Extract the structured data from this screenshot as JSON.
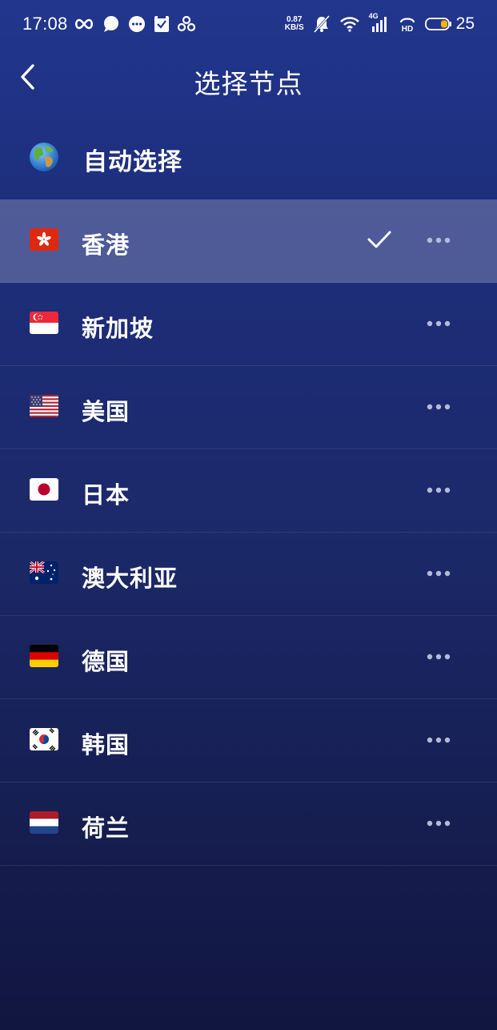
{
  "status_bar": {
    "time": "17:08",
    "net_speed_value": "0.87",
    "net_speed_unit": "KB/S",
    "network_type": "4G",
    "battery_level": "25",
    "icons": [
      "infinity-icon",
      "chat-bubble-icon",
      "message-icon",
      "clipboard-icon",
      "link-icon",
      "mute-icon",
      "wifi-icon",
      "signal-icon",
      "hd-icon",
      "battery-icon"
    ]
  },
  "header": {
    "back_icon": "chevron-left-icon",
    "title": "选择节点"
  },
  "auto_select": {
    "icon": "globe-icon",
    "label": "自动选择"
  },
  "servers": [
    {
      "name": "香港",
      "flag": "hong-kong-flag-icon",
      "selected": true
    },
    {
      "name": "新加坡",
      "flag": "singapore-flag-icon",
      "selected": false
    },
    {
      "name": "美国",
      "flag": "us-flag-icon",
      "selected": false
    },
    {
      "name": "日本",
      "flag": "japan-flag-icon",
      "selected": false
    },
    {
      "name": "澳大利亚",
      "flag": "australia-flag-icon",
      "selected": false
    },
    {
      "name": "德国",
      "flag": "germany-flag-icon",
      "selected": false
    },
    {
      "name": "韩国",
      "flag": "korea-flag-icon",
      "selected": false
    },
    {
      "name": "荷兰",
      "flag": "netherlands-flag-icon",
      "selected": false
    }
  ],
  "colors": {
    "background_top": "#22368e",
    "background_bottom": "#111640",
    "selected_row": "#4d5d9c",
    "text": "#ffffff",
    "more_dots": "#b4bbd8"
  }
}
